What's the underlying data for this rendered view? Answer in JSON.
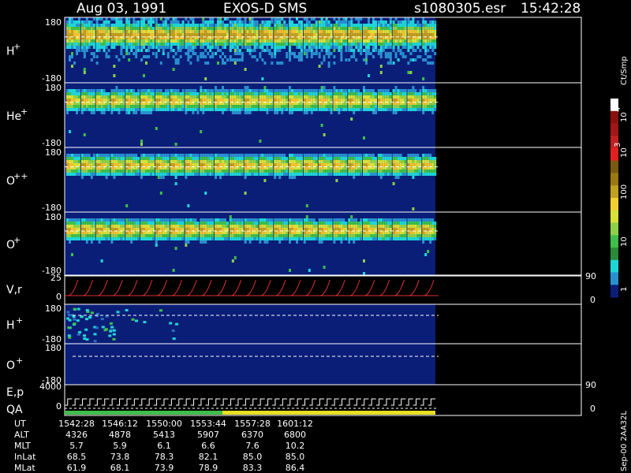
{
  "header": {
    "date": "Aug 03, 1991",
    "instrument": "EXOS-D SMS",
    "file": "s1080305.esr",
    "time": "15:42:28"
  },
  "colorbar": {
    "unit": "Ct/Smp",
    "labels": [
      "10",
      "4",
      "10",
      "3",
      "100",
      "10",
      "1"
    ]
  },
  "footer_note": "Sep-00 2AA32L",
  "orbit": {
    "rows": [
      {
        "name": "UT",
        "values": [
          "1542:28",
          "1546:12",
          "1550:00",
          "1553:44",
          "1557:28",
          "1601:12"
        ]
      },
      {
        "name": "ALT",
        "values": [
          "4326",
          "4878",
          "5413",
          "5907",
          "6370",
          "6800"
        ]
      },
      {
        "name": "MLT",
        "values": [
          "5.7",
          "5.9",
          "6.1",
          "6.6",
          "7.6",
          "10.2"
        ]
      },
      {
        "name": "InLat",
        "values": [
          "68.5",
          "73.8",
          "78.3",
          "82.1",
          "85.0",
          "85.0"
        ]
      },
      {
        "name": "MLat",
        "values": [
          "61.9",
          "68.1",
          "73.9",
          "78.9",
          "83.3",
          "86.4"
        ]
      }
    ]
  },
  "chart_data": {
    "type": "heatmap",
    "panels": [
      {
        "id": "h",
        "label": "H",
        "sup": "+",
        "ytick_top": "180",
        "ytick_bottom": "-180",
        "ylim": [
          -180,
          180
        ],
        "peak": 1.0,
        "halo": 0.55,
        "noise": 0.35
      },
      {
        "id": "he",
        "label": "He",
        "sup": "+",
        "ytick_top": "180",
        "ytick_bottom": "-180",
        "ylim": [
          -180,
          180
        ],
        "peak": 0.85,
        "halo": 0.2,
        "noise": 0.15
      },
      {
        "id": "opp",
        "label": "O",
        "sup": "++",
        "ytick_top": "180",
        "ytick_bottom": "-180",
        "ylim": [
          -180,
          180
        ],
        "peak": 0.9,
        "halo": 0.15,
        "noise": 0.1
      },
      {
        "id": "op",
        "label": "O",
        "sup": "+",
        "ytick_top": "180",
        "ytick_bottom": "-180",
        "ylim": [
          -180,
          180
        ],
        "peak": 0.95,
        "halo": 0.15,
        "noise": 0.12
      }
    ],
    "vr_panel": {
      "label": "V,r",
      "ytick_top": "25",
      "ytick_mid": "0",
      "right_top": "90",
      "right_bottom": "0"
    },
    "h2_panel": {
      "label": "H",
      "sup": "+",
      "ytick_top": "180",
      "ytick_bottom": "-180"
    },
    "o2_panel": {
      "label": "O",
      "sup": "+",
      "ytick_top": "180",
      "ytick_bottom": "-180"
    },
    "ep_panel": {
      "label_top": "E,p",
      "label_bottom": "QA",
      "ytick_top": "4000",
      "ytick_mid": "0",
      "right_top": "90",
      "right_bottom": "0"
    },
    "spin_count": 25
  }
}
